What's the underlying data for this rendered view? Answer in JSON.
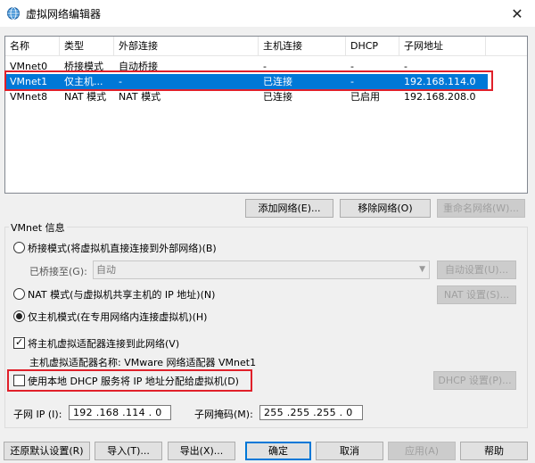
{
  "window": {
    "title": "虚拟网络编辑器",
    "close_symbol": "✕"
  },
  "netlist": {
    "columns": [
      "名称",
      "类型",
      "外部连接",
      "主机连接",
      "DHCP",
      "子网地址"
    ],
    "rows": [
      [
        "VMnet0",
        "桥接模式",
        "自动桥接",
        "-",
        "-",
        "-"
      ],
      [
        "VMnet1",
        "仅主机...",
        "-",
        "已连接",
        "-",
        "192.168.114.0"
      ],
      [
        "VMnet8",
        "NAT 模式",
        "NAT 模式",
        "已连接",
        "已启用",
        "192.168.208.0"
      ]
    ],
    "selected_row": 1
  },
  "list_buttons": {
    "add": "添加网络(E)...",
    "remove": "移除网络(O)",
    "rename": "重命名网络(W)..."
  },
  "vmnet_info": {
    "legend": "VMnet 信息",
    "bridge_label": "桥接模式(将虚拟机直接连接到外部网络)(B)",
    "bridged_to_label": "已桥接至(G):",
    "bridged_to_value": "自动",
    "auto_settings": "自动设置(U)...",
    "nat_label": "NAT 模式(与虚拟机共享主机的 IP 地址)(N)",
    "nat_settings": "NAT 设置(S)...",
    "hostonly_label": "仅主机模式(在专用网络内连接虚拟机)(H)",
    "connect_adapter_label": "将主机虚拟适配器连接到此网络(V)",
    "adapter_name_label": "主机虚拟适配器名称: VMware 网络适配器 VMnet1",
    "dhcp_label": "使用本地 DHCP 服务将 IP 地址分配给虚拟机(D)",
    "dhcp_settings": "DHCP 设置(P)...",
    "subnet_ip_label": "子网 IP (I):",
    "subnet_ip_value": "192 .168 .114 . 0",
    "subnet_mask_label": "子网掩码(M):",
    "subnet_mask_value": "255 .255 .255 . 0"
  },
  "bottom_buttons": {
    "restore": "还原默认设置(R)",
    "import": "导入(T)...",
    "export": "导出(X)...",
    "ok": "确定",
    "cancel": "取消",
    "apply": "应用(A)",
    "help": "帮助"
  },
  "colors": {
    "selection": "#0078d7",
    "highlight_box": "#e0202a"
  }
}
